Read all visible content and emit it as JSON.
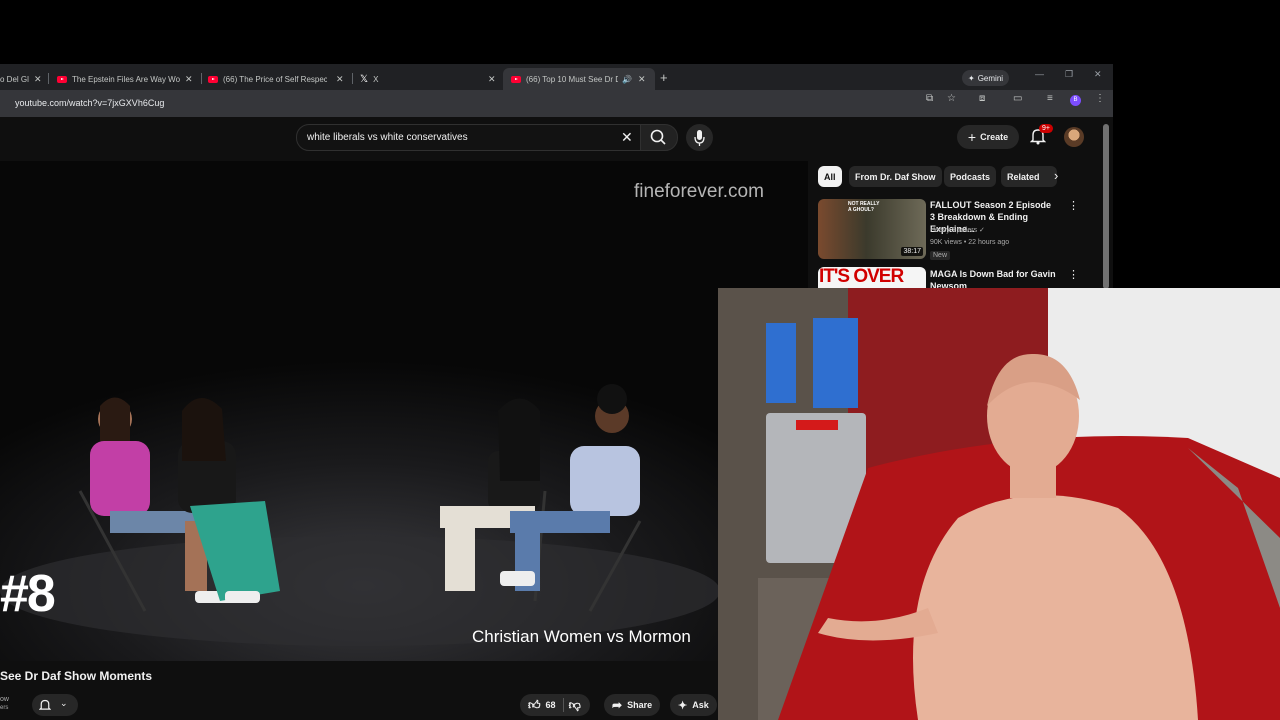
{
  "tabs": [
    {
      "title": "o Del Gl"
    },
    {
      "title": "The Epstein Files Are Way Wors"
    },
    {
      "title": "(66) The Price of Self Respect -"
    },
    {
      "title": "X"
    },
    {
      "title": "(66) Top 10 Must See Dr Da"
    }
  ],
  "gemini_label": "Gemini",
  "url": "youtube.com/watch?v=7jxGXVh6Cug",
  "profile_letter": "B",
  "search": {
    "query": "white liberals vs white conservatives"
  },
  "header": {
    "create_label": "Create",
    "notif_badge": "9+"
  },
  "video": {
    "watermark": "fineforever.com",
    "rank": "#8",
    "caption": "Christian Women vs Mormon",
    "title": "See Dr Daf Show Moments",
    "channel_frag": "ow",
    "subs_frag": "ers",
    "likes": "68",
    "share_label": "Share",
    "ask_label": "Ask"
  },
  "chips": [
    "All",
    "From Dr. Daf Show",
    "Podcasts",
    "Related"
  ],
  "recommendations": [
    {
      "title": "FALLOUT Season 2 Episode 3 Breakdown & Ending Explaine...",
      "channel": "Heavy Spoilers",
      "meta": "90K views • 22 hours ago",
      "badge": "New",
      "duration": "38:17",
      "thumb_text": "NOT REALLY A GHOUL?"
    },
    {
      "title": "MAGA Is Down Bad for Gavin Newsom",
      "thumb_text": "IT'S OVER"
    }
  ],
  "colors": {
    "accent": "#ff0033",
    "background": "#0f0f0f",
    "chip": "#272727",
    "badge": "#cc0000"
  }
}
